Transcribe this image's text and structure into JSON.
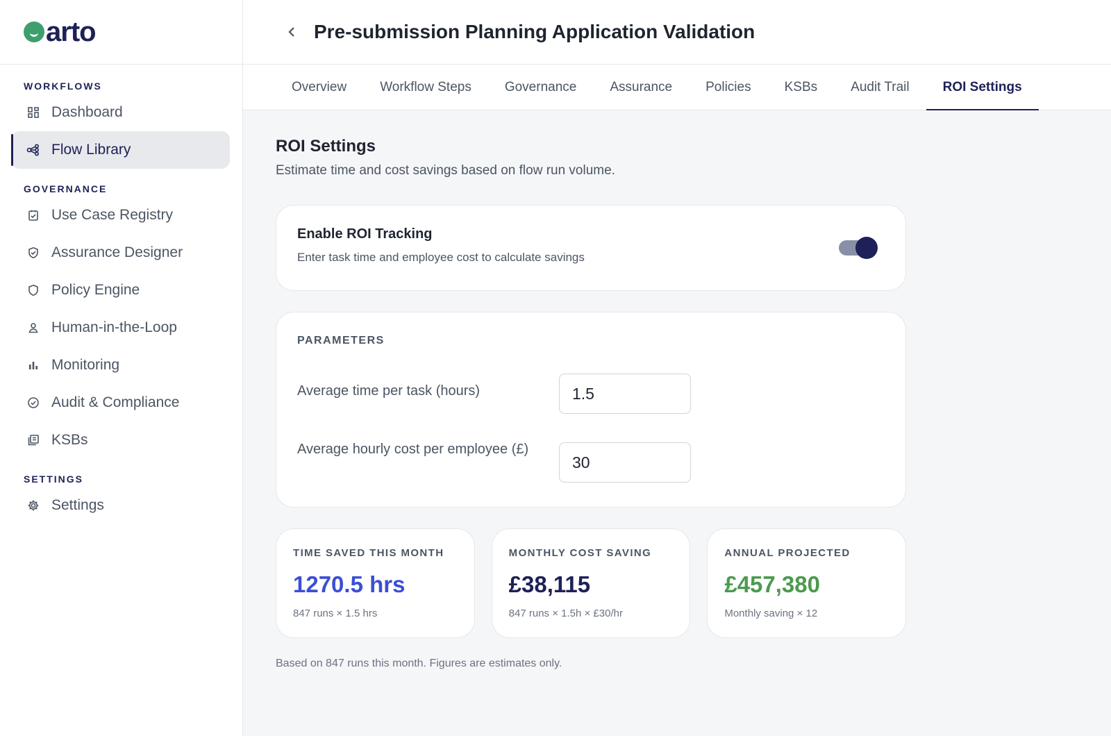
{
  "brand": {
    "name": "arto"
  },
  "sidebar": {
    "sections": [
      {
        "title": "WORKFLOWS"
      },
      {
        "title": "GOVERNANCE"
      },
      {
        "title": "SETTINGS"
      }
    ],
    "items": [
      {
        "label": "Dashboard",
        "icon": "dashboard-icon"
      },
      {
        "label": "Flow Library",
        "icon": "flow-icon",
        "active": true
      },
      {
        "label": "Use Case Registry",
        "icon": "clipboard-check-icon"
      },
      {
        "label": "Assurance Designer",
        "icon": "shield-check-icon"
      },
      {
        "label": "Policy Engine",
        "icon": "shield-icon"
      },
      {
        "label": "Human-in-the-Loop",
        "icon": "person-icon"
      },
      {
        "label": "Monitoring",
        "icon": "bar-chart-icon"
      },
      {
        "label": "Audit & Compliance",
        "icon": "check-circle-icon"
      },
      {
        "label": "KSBs",
        "icon": "library-icon"
      },
      {
        "label": "Settings",
        "icon": "gear-icon"
      }
    ]
  },
  "header": {
    "title": "Pre-submission Planning Application Validation"
  },
  "tabs": [
    {
      "label": "Overview"
    },
    {
      "label": "Workflow Steps"
    },
    {
      "label": "Governance"
    },
    {
      "label": "Assurance"
    },
    {
      "label": "Policies"
    },
    {
      "label": "KSBs"
    },
    {
      "label": "Audit Trail"
    },
    {
      "label": "ROI Settings",
      "active": true
    }
  ],
  "roi": {
    "title": "ROI Settings",
    "subtitle": "Estimate time and cost savings based on flow run volume.",
    "toggle": {
      "title": "Enable ROI Tracking",
      "description": "Enter task time and employee cost to calculate savings",
      "enabled": true
    },
    "parameters": {
      "label": "PARAMETERS",
      "time_label": "Average time per task (hours)",
      "time_value": "1.5",
      "cost_label": "Average hourly cost per employee (£)",
      "cost_value": "30"
    },
    "stats": [
      {
        "label": "TIME SAVED THIS MONTH",
        "value": "1270.5 hrs",
        "note": "847 runs × 1.5 hrs",
        "color": "#3b4fd4"
      },
      {
        "label": "MONTHLY COST SAVING",
        "value": "£38,115",
        "note": "847 runs × 1.5h × £30/hr",
        "color": "#1e2157"
      },
      {
        "label": "ANNUAL PROJECTED",
        "value": "£457,380",
        "note": "Monthly saving × 12",
        "color": "#4c9a4f"
      }
    ],
    "footnote": "Based on 847 runs this month. Figures are estimates only."
  }
}
